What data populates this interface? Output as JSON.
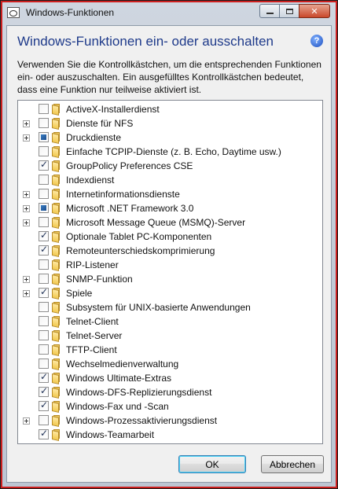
{
  "window": {
    "title": "Windows-Funktionen",
    "icon": "windows-features-icon"
  },
  "titlebar_buttons": {
    "minimize_icon": "minimize-icon",
    "maximize_icon": "maximize-icon",
    "close_label": "✕"
  },
  "dialog": {
    "heading": "Windows-Funktionen ein- oder ausschalten",
    "help_label": "?",
    "description": "Verwenden Sie die Kontrollkästchen, um die entsprechenden Funktionen ein- oder auszuschalten. Ein ausgefülltes Kontrollkästchen bedeutet, dass eine Funktion nur teilweise aktiviert ist."
  },
  "features": [
    {
      "label": "ActiveX-Installerdienst",
      "state": "unchecked",
      "expandable": false
    },
    {
      "label": "Dienste für NFS",
      "state": "unchecked",
      "expandable": true
    },
    {
      "label": "Druckdienste",
      "state": "partial",
      "expandable": true
    },
    {
      "label": "Einfache TCPIP-Dienste (z. B. Echo, Daytime usw.)",
      "state": "unchecked",
      "expandable": false
    },
    {
      "label": "GroupPolicy Preferences CSE",
      "state": "checked",
      "expandable": false
    },
    {
      "label": "Indexdienst",
      "state": "unchecked",
      "expandable": false
    },
    {
      "label": "Internetinformationsdienste",
      "state": "unchecked",
      "expandable": true
    },
    {
      "label": "Microsoft .NET Framework 3.0",
      "state": "partial",
      "expandable": true
    },
    {
      "label": "Microsoft Message Queue (MSMQ)-Server",
      "state": "unchecked",
      "expandable": true
    },
    {
      "label": "Optionale Tablet PC-Komponenten",
      "state": "checked",
      "expandable": false
    },
    {
      "label": "Remoteunterschiedskomprimierung",
      "state": "checked",
      "expandable": false
    },
    {
      "label": "RIP-Listener",
      "state": "unchecked",
      "expandable": false
    },
    {
      "label": "SNMP-Funktion",
      "state": "unchecked",
      "expandable": true
    },
    {
      "label": "Spiele",
      "state": "checked",
      "expandable": true
    },
    {
      "label": "Subsystem für UNIX-basierte Anwendungen",
      "state": "unchecked",
      "expandable": false
    },
    {
      "label": "Telnet-Client",
      "state": "unchecked",
      "expandable": false
    },
    {
      "label": "Telnet-Server",
      "state": "unchecked",
      "expandable": false
    },
    {
      "label": "TFTP-Client",
      "state": "unchecked",
      "expandable": false
    },
    {
      "label": "Wechselmedienverwaltung",
      "state": "unchecked",
      "expandable": false
    },
    {
      "label": "Windows Ultimate-Extras",
      "state": "checked",
      "expandable": false
    },
    {
      "label": "Windows-DFS-Replizierungsdienst",
      "state": "checked",
      "expandable": false
    },
    {
      "label": "Windows-Fax und -Scan",
      "state": "checked",
      "expandable": false
    },
    {
      "label": "Windows-Prozessaktivierungsdienst",
      "state": "unchecked",
      "expandable": true
    },
    {
      "label": "Windows-Teamarbeit",
      "state": "checked",
      "expandable": false
    }
  ],
  "buttons": {
    "ok_label": "OK",
    "cancel_label": "Abbrechen"
  },
  "colors": {
    "heading": "#1e3a8a",
    "partial_fill": "#2a5fa3",
    "close_button": "#c9482b",
    "highlight_outline": "#cc1f1f"
  }
}
